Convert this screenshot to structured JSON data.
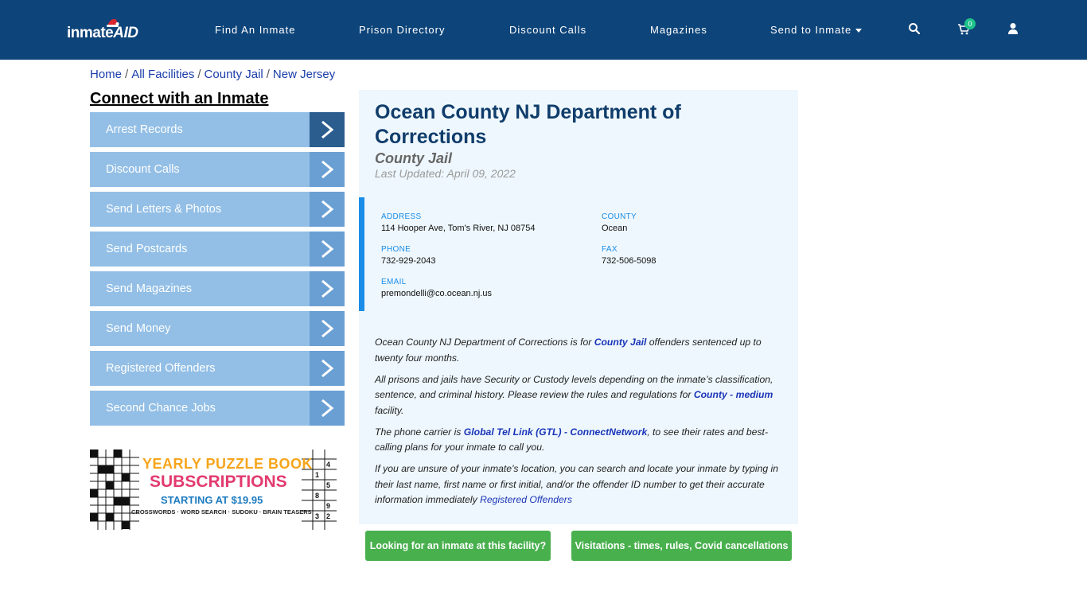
{
  "header": {
    "logo_text_a": "inmate",
    "logo_text_b": "AID",
    "nav": [
      "Find An Inmate",
      "Prison Directory",
      "Discount Calls",
      "Magazines",
      "Send to Inmate"
    ],
    "cart_count": "0",
    "icons": [
      "search-icon",
      "cart-icon",
      "user-icon"
    ],
    "colors": {
      "bar": "#0d4479",
      "badge": "#1ec28b"
    }
  },
  "breadcrumb": {
    "items": [
      "Home",
      "All Facilities",
      "County Jail",
      "New Jersey"
    ],
    "separator": "/"
  },
  "sidebar": {
    "title": "Connect with an Inmate",
    "items": [
      "Arrest Records",
      "Discount Calls",
      "Send Letters & Photos",
      "Send Postcards",
      "Send Magazines",
      "Send Money",
      "Registered Offenders",
      "Second Chance Jobs"
    ],
    "promo": {
      "line1": "YEARLY PUZZLE BOOK",
      "line2": "SUBSCRIPTIONS",
      "line3": "STARTING AT $19.95",
      "line4": "CROSSWORDS · WORD SEARCH · SUDOKU · BRAIN TEASERS"
    }
  },
  "facility": {
    "name": "Ocean County NJ Department of Corrections",
    "type": "County Jail",
    "updated": "Last Updated: April 09, 2022",
    "address_label": "ADDRESS",
    "address": "114 Hooper Ave, Tom's River, NJ 08754",
    "county_label": "COUNTY",
    "county": "Ocean",
    "phone_label": "PHONE",
    "phone": "732-929-2043",
    "fax_label": "FAX",
    "fax": "732-506-5098",
    "email_label": "EMAIL",
    "email": "premondelli@co.ocean.nj.us"
  },
  "description": {
    "p1_a": "Ocean County NJ Department of Corrections is for ",
    "p1_link": "County Jail",
    "p1_b": " offenders sentenced up to twenty four months.",
    "p2_a": "All prisons and jails have Security or Custody levels depending on the inmate’s classification, sentence, and criminal history. Please review the rules and regulations for ",
    "p2_link": "County - medium",
    "p2_b": " facility.",
    "p3_a": "The phone carrier is ",
    "p3_link1": "Global Tel Link (GTL)",
    "p3_dash": " - ",
    "p3_link2": "ConnectNetwork",
    "p3_b": ", to see their rates and best-calling plans for your inmate to call you.",
    "p4_a": "If you are unsure of your inmate's location, you can search and locate your inmate by typing in their last name, first name or first initial, and/or the offender ID number to get their accurate information immediately ",
    "p4_link": "Registered Offenders"
  },
  "buttons": {
    "find": "Looking for an inmate at this facility?",
    "visit": "Visitations - times, rules, Covid cancellations"
  }
}
